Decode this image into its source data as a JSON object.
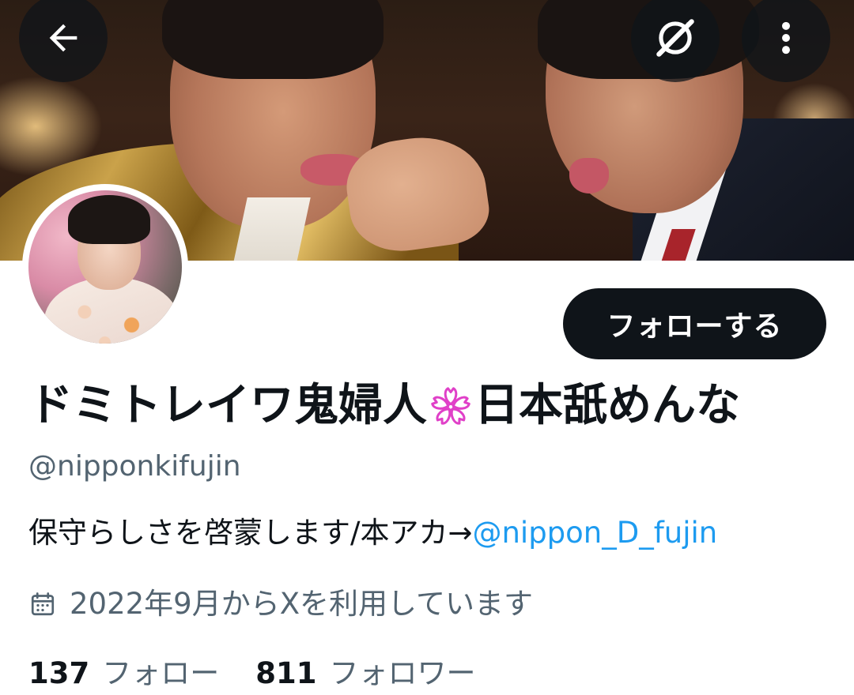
{
  "profile": {
    "display_name_before": "ドミトレイワ鬼婦人",
    "display_name_after": "日本舐めんな",
    "name_emoji": "sakura-blossom",
    "handle": "@nipponkifujin",
    "bio_text": "保守らしさを啓蒙します/本アカ→",
    "bio_mention": "@nippon_D_fujin",
    "joined": "2022年9月からXを利用しています",
    "following_count": "137",
    "following_label": "フォロー",
    "followers_count": "811",
    "followers_label": "フォロワー"
  },
  "actions": {
    "follow_label": "フォローする"
  },
  "icons": {
    "back": "arrow-left-icon",
    "spaces": "slashed-circle-icon",
    "more": "more-vertical-icon",
    "calendar": "calendar-icon"
  },
  "colors": {
    "text_primary": "#0f1419",
    "text_secondary": "#536471",
    "link": "#1d9bf0",
    "follow_button_bg": "#0f1419",
    "sakura": "#e040c8"
  }
}
